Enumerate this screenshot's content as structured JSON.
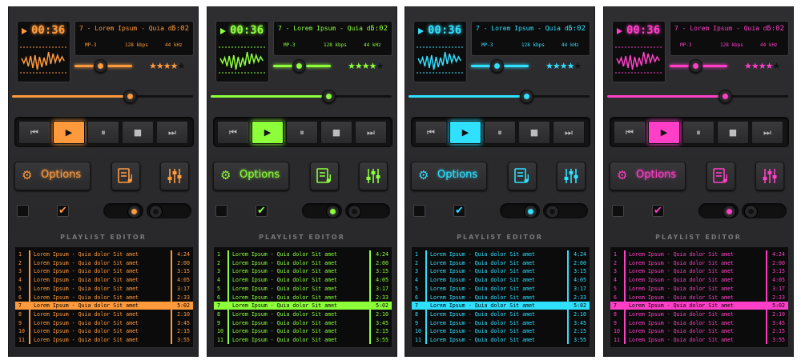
{
  "themes": [
    {
      "name": "orange",
      "accent": "#ff9a3c"
    },
    {
      "name": "green",
      "accent": "#8cff3a"
    },
    {
      "name": "cyan",
      "accent": "#2fe0ff"
    },
    {
      "name": "pink",
      "accent": "#ff3fc7"
    }
  ],
  "player": {
    "mini_time": "00:36",
    "track_title": "7 - Lorem Ipsum - Quia do",
    "track_time": "5:02",
    "format": "MP-3",
    "bitrate": "128 kbps",
    "khz": "44 kHz",
    "rating": 4,
    "rating_max": 5,
    "volume_level": 0.45,
    "seek_progress": 0.65
  },
  "transport": {
    "prev": "⏮",
    "play": "▶",
    "pause": "⏸",
    "stop": "■",
    "next": "⏭"
  },
  "options_label": "Options",
  "icons": {
    "options": "gear-icon",
    "playlist": "playlist-note-icon",
    "equalizer": "equalizer-icon",
    "check": "✔"
  },
  "playlist": {
    "title": "PLAYLIST EDITOR",
    "selected_index": 6,
    "rows": [
      {
        "n": "1",
        "title": "Lorem Ipsum - Quia dolor Sit amet",
        "time": "4:24"
      },
      {
        "n": "2",
        "title": "Lorem Ipsum - Quia dolor Sit amet",
        "time": "2:00"
      },
      {
        "n": "3",
        "title": "Lorem Ipsum - Quia dolor Sit amet",
        "time": "3:15"
      },
      {
        "n": "4",
        "title": "Lorem Ipsum - Quia dolor Sit amet",
        "time": "4:05"
      },
      {
        "n": "5",
        "title": "Lorem Ipsum - Quia dolor Sit amet",
        "time": "3:17"
      },
      {
        "n": "6",
        "title": "Lorem Ipsum - Quia dolor Sit amet",
        "time": "2:33"
      },
      {
        "n": "7",
        "title": "Lorem Ipsum - Quia dolor Sit amet",
        "time": "5:02"
      },
      {
        "n": "8",
        "title": "Lorem Ipsum - Quia dolor Sit amet",
        "time": "2:10"
      },
      {
        "n": "9",
        "title": "Lorem Ipsum - Quia dolor Sit amet",
        "time": "3:45"
      },
      {
        "n": "10",
        "title": "Lorem Ipsum - Quia dolor Sit amet",
        "time": "2:15"
      },
      {
        "n": "11",
        "title": "Lorem Ipsum - Quia dolor Sit amet",
        "time": "3:55"
      }
    ]
  }
}
